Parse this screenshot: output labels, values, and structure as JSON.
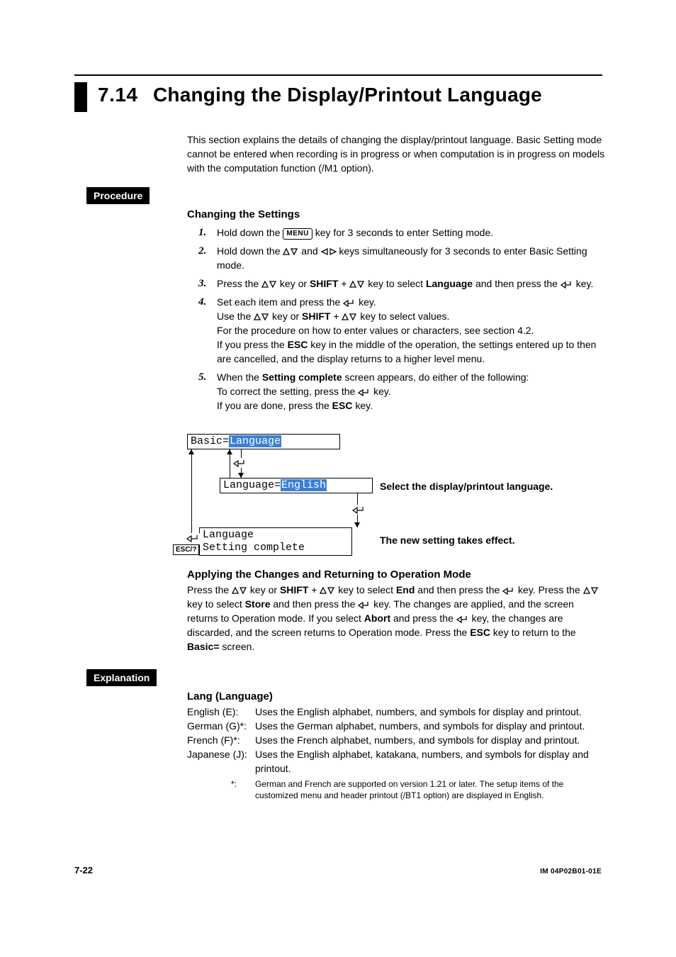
{
  "section": {
    "number": "7.14",
    "title": "Changing the Display/Printout Language"
  },
  "intro": "This section explains the details of changing the display/printout language. Basic Setting mode cannot be entered when recording is in progress or when computation is in progress on models with the computation function (/M1 option).",
  "labels": {
    "procedure": "Procedure",
    "explanation": "Explanation"
  },
  "subheads": {
    "changing": "Changing the Settings",
    "applying": "Applying the Changes and Returning to Operation Mode",
    "lang": "Lang (Language)"
  },
  "keys": {
    "menu": "MENU",
    "shift": "SHIFT",
    "esc": "ESC",
    "esc_q": "ESC/?"
  },
  "steps": {
    "s1_a": "Hold down the ",
    "s1_b": " key for 3 seconds to enter Setting mode.",
    "s2_a": "Hold down the ",
    "s2_b": " and ",
    "s2_c": " keys simultaneously for 3 seconds to enter Basic Setting mode.",
    "s3_a": "Press the ",
    "s3_b": " key or ",
    "s3_c": " + ",
    "s3_d": " key to select ",
    "s3_lang": "Language",
    "s3_e": " and then press the ",
    "s3_f": " key.",
    "s4_a": "Set each item and press the ",
    "s4_b": " key.",
    "s4_c": "Use the ",
    "s4_d": " key or ",
    "s4_e": " + ",
    "s4_f": " key to select values.",
    "s4_g": "For the procedure on how to enter values or characters, see section 4.2.",
    "s4_h": "If you press the ",
    "s4_i": " key in the middle of the operation, the settings entered up to then are cancelled, and the display returns to a higher level menu.",
    "s5_a": "When the ",
    "s5_sc": "Setting complete",
    "s5_b": " screen appears, do either of the following:",
    "s5_c": "To correct the setting, press the ",
    "s5_d": " key.",
    "s5_e": "If you are done, press the ",
    "s5_f": " key."
  },
  "diagram": {
    "basic_eq": "Basic=",
    "basic_val": "Language",
    "lang_eq": "Language=",
    "lang_val": "English",
    "line1": "Language",
    "line2": "Setting complete",
    "label_select": "Select the display/printout language.",
    "label_effect": "The new setting takes effect."
  },
  "apply": {
    "a1": "Press the ",
    "a2": " key or ",
    "a3": " + ",
    "a4": " key to select ",
    "end": "End",
    "a5": " and then press the ",
    "a6": " key. Press the ",
    "a7": " key to select ",
    "store": "Store",
    "a8": " and then press the ",
    "a9": " key. The changes are applied, and the screen returns to Operation mode. If you select ",
    "abort": "Abort",
    "a10": " and press the ",
    "a11": " key, the changes are discarded, and the screen returns to Operation mode. Press the ",
    "a12": " key to return to the ",
    "basic_eq": "Basic=",
    "a13": " screen."
  },
  "lang": {
    "rows": [
      {
        "key": "English (E):",
        "desc": "Uses the English alphabet, numbers, and symbols for display and printout."
      },
      {
        "key": "German (G)*:",
        "desc": "Uses the German alphabet, numbers, and symbols for display and printout."
      },
      {
        "key": "French (F)*:",
        "desc": "Uses the French alphabet, numbers, and symbols for display and printout."
      },
      {
        "key": "Japanese (J):",
        "desc": "Uses the English alphabet, katakana, numbers, and symbols for display and printout."
      }
    ],
    "footnote_mark": "*:",
    "footnote": "German and French are supported on version 1.21 or later. The setup items of the customized menu and header printout (/BT1 option) are displayed in English."
  },
  "footer": {
    "page": "7-22",
    "doc_id": "IM 04P02B01-01E"
  }
}
